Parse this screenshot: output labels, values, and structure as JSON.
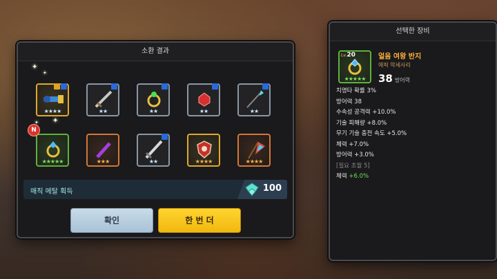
{
  "summon": {
    "title": "소환 결과",
    "new_badge": "N",
    "items": [
      {
        "name": "청룡 대포",
        "stars": "★★★★",
        "star_color": "w",
        "frame": "gold",
        "badges": [
          "M",
          "X"
        ]
      },
      {
        "name": "검",
        "stars": "★★",
        "star_color": "w",
        "frame": "silver",
        "badges": [
          "M"
        ]
      },
      {
        "name": "반지",
        "stars": "★★",
        "star_color": "w",
        "frame": "silver",
        "badges": [
          "M"
        ]
      },
      {
        "name": "보석",
        "stars": "★★",
        "star_color": "w",
        "frame": "silver",
        "badges": [
          "M"
        ]
      },
      {
        "name": "창",
        "stars": "★★",
        "star_color": "w",
        "frame": "silver",
        "badges": [
          "M"
        ]
      },
      {
        "name": "얼음 여왕 반지",
        "stars": "★★★★★",
        "star_color": "g",
        "frame": "green",
        "badges": []
      },
      {
        "name": "보라 검",
        "stars": "★★★",
        "star_color": "o",
        "frame": "orange",
        "badges": []
      },
      {
        "name": "대검",
        "stars": "★★",
        "star_color": "w",
        "frame": "silver",
        "badges": [
          "M"
        ]
      },
      {
        "name": "방패",
        "stars": "★★★★",
        "star_color": "o",
        "frame": "gold",
        "badges": []
      },
      {
        "name": "무지개 깃발",
        "stars": "★★★★",
        "star_color": "o",
        "frame": "orange",
        "badges": []
      }
    ],
    "magic_metal_label": "매직 메탈 획득",
    "magic_metal_value": "100",
    "confirm_label": "확인",
    "again_label": "한 번 더"
  },
  "detail": {
    "title": "선택한 장비",
    "lv_label": "Lv.",
    "level": "20",
    "stars": "★★★★★",
    "name": "얼음 여왕 반지",
    "grade": "에픽 악세사리",
    "main_value": "38",
    "main_stat": "방어력",
    "lines": [
      "치명타 확률 3%",
      "방어력 38",
      "수속성 공격력 +10.0%",
      "기술 피해량 +8.0%",
      "무기 기술 충전 속도 +5.0%",
      "체력 +7.0%",
      "방어력 +3.0%"
    ],
    "requirement": "[필요 초월 5]",
    "bonus_label": "체력",
    "bonus_value": "+6.0%"
  }
}
